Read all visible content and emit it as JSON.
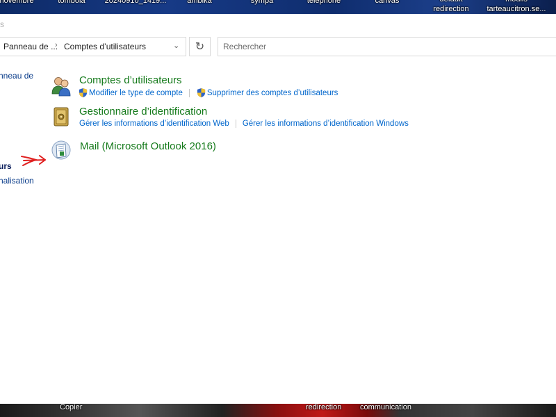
{
  "desktop": {
    "top_labels": [
      "novembre",
      "tombola",
      "20240910_1419...",
      "ambika",
      "sympa",
      "telephone",
      "canvas",
      "default redirection",
      "moulis tarteaucitron.se..."
    ],
    "bottom_labels": [
      "Copier",
      "redirection",
      "communication"
    ]
  },
  "window": {
    "top_fragment": "s",
    "breadcrumb": {
      "parent": "Panneau de ...",
      "current": "Comptes d’utilisateurs"
    },
    "search": {
      "placeholder": "Rechercher",
      "value": ""
    },
    "left_nav": {
      "link_fragment": "nneau de",
      "current_fragment": "urs",
      "link2_fragment": "nalisation"
    },
    "items": [
      {
        "title": "Comptes d’utilisateurs",
        "icon": "users-icon",
        "links": [
          "Modifier le type de compte",
          "Supprimer des comptes d’utilisateurs"
        ]
      },
      {
        "title": "Gestionnaire d’identification",
        "icon": "credential-vault-icon",
        "links": [
          "Gérer les informations d’identification Web",
          "Gérer les informations d’identification Windows"
        ]
      },
      {
        "title": "Mail (Microsoft Outlook 2016)",
        "icon": "mail-icon",
        "links": []
      }
    ]
  },
  "colors": {
    "item_title": "#157a1b",
    "link": "#0066cc",
    "annotation_arrow": "#e02020"
  }
}
